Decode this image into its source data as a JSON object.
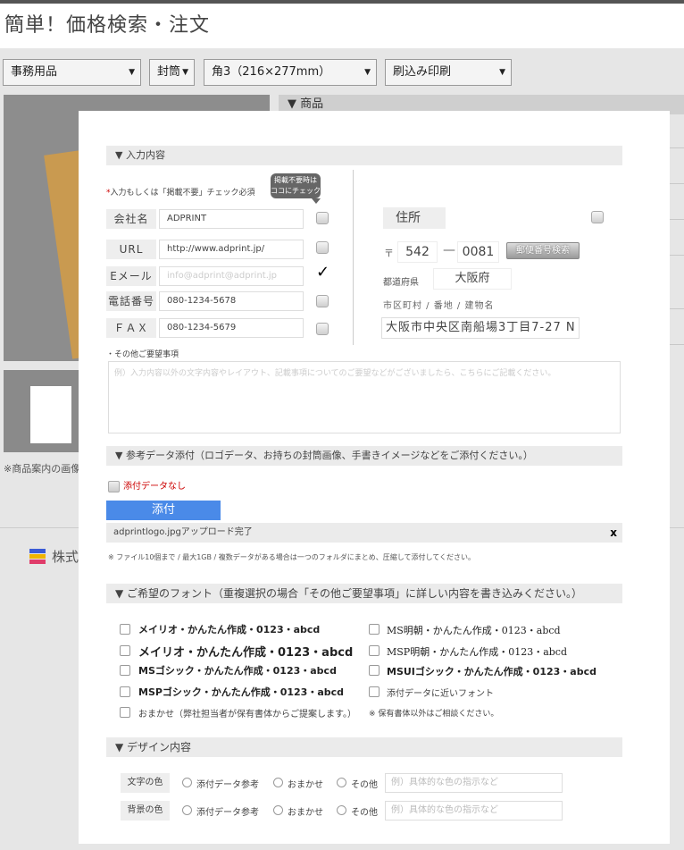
{
  "page_title": "簡単！価格検索・注文",
  "selectors": [
    {
      "value": "事務用品"
    },
    {
      "value": "封筒"
    },
    {
      "value": "角3（216×277mm）"
    },
    {
      "value": "刷込み印刷"
    }
  ],
  "background": {
    "product_header": "▼ 商品",
    "note": "※商品案内の画像",
    "company": "株式"
  },
  "input_section": {
    "title": "▼ 入力内容",
    "required_note_mark": "*",
    "required_note": "入力もしくは「掲載不要」チェック必須",
    "bubble_line1": "掲載不要時は",
    "bubble_line2": "ココにチェック✓",
    "fields": [
      {
        "label": "会社名",
        "value": "ADPRINT",
        "placeholder": false,
        "checked": false
      },
      {
        "label": "URL",
        "value": "http://www.adprint.jp/",
        "placeholder": false,
        "checked": false
      },
      {
        "label": "Eメール",
        "value": "info@adprint@adprint.jp",
        "placeholder": true,
        "checked": true
      },
      {
        "label": "電話番号",
        "value": "080-1234-5678",
        "placeholder": false,
        "checked": false
      },
      {
        "label": "ＦＡＸ",
        "value": "080-1234-5679",
        "placeholder": false,
        "checked": false
      }
    ],
    "check_mark": "✓",
    "address": {
      "label": "住所",
      "zip_mark": "〒",
      "zip1": "542",
      "zip_sep": "—",
      "zip2": "0081",
      "zip_button": "郵便番号検索",
      "pref_label": "都道府県",
      "pref_value": "大阪府",
      "city_label": "市区町村 / 番地 / 建物名",
      "city_value": "大阪市中央区南船場3丁目7-27 N"
    },
    "request_label": "・その他ご要望事項",
    "request_placeholder": "例）入力内容以外の文字内容やレイアウト、記載事項についてのご要望などがございましたら、こちらにご記載ください。"
  },
  "attach_section": {
    "title": "▼ 参考データ添付（ロゴデータ、お持ちの封筒画像、手書きイメージなどをご添付ください。）",
    "no_data_label": "添付データなし",
    "attach_button": "添付",
    "uploaded": "adprintlogo.jpgアップロード完了",
    "remove": "x",
    "note": "※ ファイル10個まで / 最大1GB / 複数データがある場合は一つのフォルダにまとめ、圧縮して添付してください。"
  },
  "font_section": {
    "title": "▼ ご希望のフォント（重複選択の場合「その他ご要望事項」に詳しい内容を書き込みください。）",
    "fonts_left": [
      {
        "label": "メイリオ・かんたん作成・0123・abcd",
        "style": "sb"
      },
      {
        "label": "メイリオ・かんたん作成・0123・abcd",
        "style": "b"
      },
      {
        "label": "MSゴシック・かんたん作成・0123・abcd",
        "style": "sb"
      },
      {
        "label": "MSPゴシック・かんたん作成・0123・abcd",
        "style": "sb"
      },
      {
        "label": "おまかせ（弊社担当者が保有書体からご提案します。）",
        "style": "small"
      }
    ],
    "fonts_right": [
      {
        "label": "MS明朝・かんたん作成・0123・abcd",
        "style": "serif"
      },
      {
        "label": "MSP明朝・かんたん作成・0123・abcd",
        "style": "serif"
      },
      {
        "label": "MSUIゴシック・かんたん作成・0123・abcd",
        "style": "sb"
      },
      {
        "label": "添付データに近いフォント",
        "style": "small"
      }
    ],
    "note": "※ 保有書体以外はご相談ください。"
  },
  "design_section": {
    "title": "▼ デザイン内容",
    "rows": [
      {
        "label": "文字の色",
        "options": [
          "添付データ参考",
          "おまかせ",
          "その他"
        ],
        "placeholder": "例）具体的な色の指示など"
      },
      {
        "label": "背景の色",
        "options": [
          "添付データ参考",
          "おまかせ",
          "その他"
        ],
        "placeholder": "例）具体的な色の指示など"
      }
    ]
  }
}
